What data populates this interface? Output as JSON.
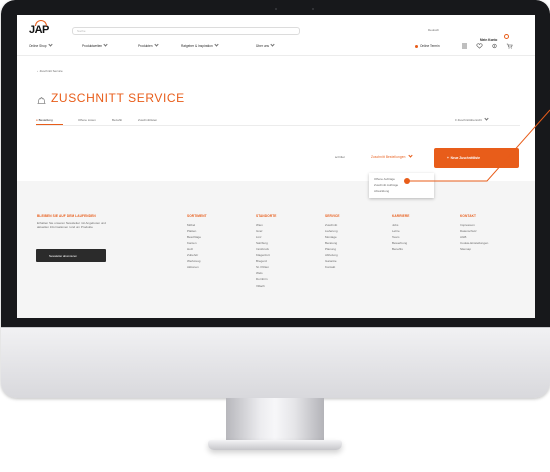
{
  "header": {
    "logo": "JAP",
    "search_placeholder": "Suche",
    "lang": "Deutsch",
    "account": "Mein Konto",
    "nav": [
      "Online Shop",
      "Produktwelten",
      "Produkten",
      "Ratgeber & Inspiration",
      "Über uns"
    ],
    "online_termin": "Online Termin",
    "icons": [
      "menu-icon",
      "heart-icon",
      "settings-icon",
      "cart-icon"
    ]
  },
  "breadcrumb": {
    "back": "Zuschnitt Service"
  },
  "page": {
    "title": "ZUSCHNITT SERVICE"
  },
  "tabs": [
    "Bestellung",
    "Offene Listen",
    "Bezahlt",
    "Zuschnittlisten"
  ],
  "cut_overview": "Zuschnittübersicht",
  "toolbar": {
    "filter_label": "Filter",
    "filter_value": "Zuschnitt Bestellungen",
    "new_button": "Neue Zuschnittliste"
  },
  "dropdown": [
    "Offene Aufträge",
    "Zuschnitt Aufträge",
    "Abwicklung"
  ],
  "footer": {
    "heading": "BLEIBEN SIE AUF DEM LAUFENDEN",
    "text1": "Erhalten Sie unseren Newsletter mit Angeboten und",
    "text2": "aktuellen Informationen rund um Produkte",
    "newsletter_button": "Newsletter abonnieren",
    "columns": [
      {
        "heading": "SORTIMENT",
        "items": [
          "Möbel",
          "Platten",
          "Beschläge",
          "Kanten",
          "Holz",
          "Zubehör",
          "Werkzeug",
          "Aktionen"
        ]
      },
      {
        "heading": "STANDORTE",
        "items": [
          "Wien",
          "Graz",
          "Linz",
          "Salzburg",
          "Innsbruck",
          "Klagenfurt",
          "Bregenz",
          "St. Pölten",
          "Wels",
          "Dornbirn",
          "Villach"
        ]
      },
      {
        "heading": "SERVICE",
        "items": [
          "Zuschnitt",
          "Lieferung",
          "Montage",
          "Beratung",
          "Planung",
          "Abholung",
          "Garantie",
          "Kontakt"
        ]
      },
      {
        "heading": "KARRIERE",
        "items": [
          "Jobs",
          "Lehre",
          "Team",
          "Bewerbung",
          "Benefits"
        ]
      },
      {
        "heading": "KONTAKT",
        "items": [
          "Impressum",
          "Datenschutz",
          "AGB",
          "Cookie-Einstellungen",
          "Sitemap"
        ]
      }
    ]
  },
  "colors": {
    "accent": "#e85d1a",
    "dark": "#17181b"
  }
}
